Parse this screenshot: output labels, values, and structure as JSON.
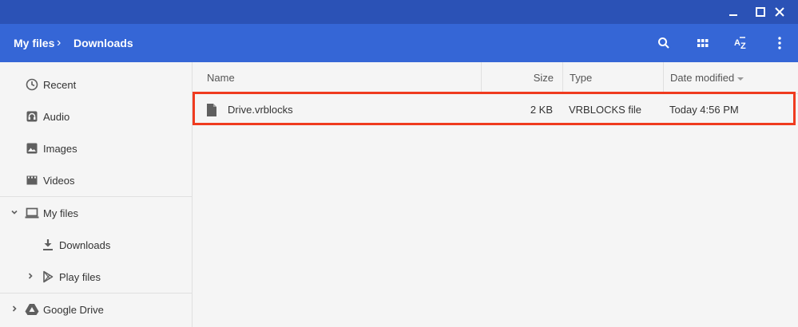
{
  "window": {
    "controls": [
      "minimize-icon",
      "maximize-icon",
      "close-icon"
    ]
  },
  "header": {
    "breadcrumb": [
      {
        "label": "My files"
      },
      {
        "label": "Downloads"
      }
    ],
    "separator": "›",
    "actions": [
      "search-icon",
      "grid-view-icon",
      "sort-az-icon",
      "more-vert-icon"
    ]
  },
  "sidebar": {
    "items": [
      {
        "label": "Recent",
        "icon": "clock-icon"
      },
      {
        "label": "Audio",
        "icon": "headphones-icon"
      },
      {
        "label": "Images",
        "icon": "image-icon"
      },
      {
        "label": "Videos",
        "icon": "film-icon"
      },
      {
        "label": "My files",
        "icon": "laptop-icon",
        "expanded": true
      },
      {
        "label": "Downloads",
        "icon": "download-icon",
        "selected": true
      },
      {
        "label": "Play files",
        "icon": "play-store-icon",
        "expanded": false
      },
      {
        "label": "Google Drive",
        "icon": "drive-icon",
        "expanded": false
      }
    ]
  },
  "table": {
    "columns": [
      "Name",
      "Size",
      "Type",
      "Date modified"
    ],
    "sort_column": "Date modified",
    "rows": [
      {
        "name": "Drive.vrblocks",
        "size": "2 KB",
        "type": "VRBLOCKS file",
        "date": "Today 4:56 PM",
        "icon": "file-icon"
      }
    ]
  },
  "colors": {
    "titlebar": "#2b52b6",
    "header": "#3566d6",
    "highlight_border": "#ef3b1f"
  }
}
